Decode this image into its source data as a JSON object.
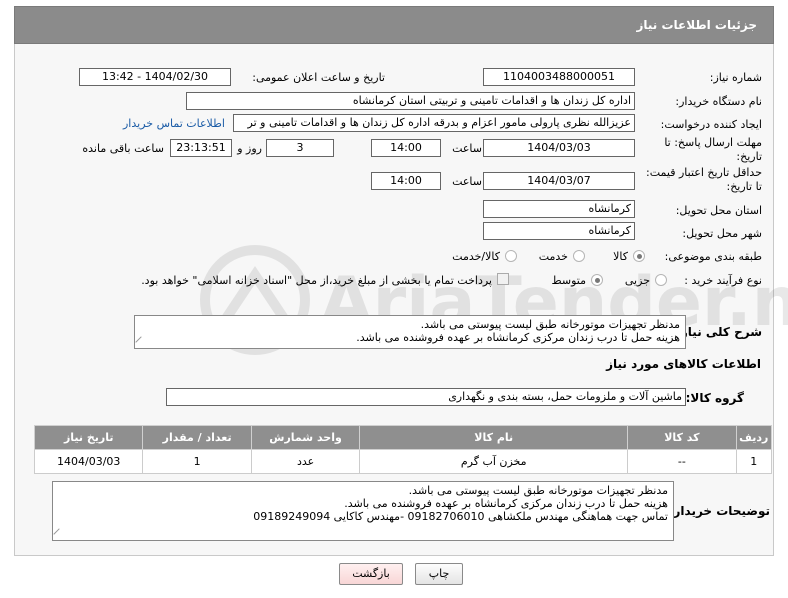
{
  "header": {
    "title": "جزئیات اطلاعات نیاز"
  },
  "fields": {
    "need_number_label": "شماره نیاز:",
    "need_number": "1104003488000051",
    "announce_label": "تاریخ و ساعت اعلان عمومی:",
    "announce_value": "1404/02/30 - 13:42",
    "buyer_org_label": "نام دستگاه خریدار:",
    "buyer_org": "اداره کل زندان ها و اقدامات تامینی و تربیتی استان کرمانشاه",
    "requester_label": "ایجاد کننده درخواست:",
    "requester": "عزیزالله نظری پارولی مامور اعزام و بدرقه اداره کل زندان ها و اقدامات تامینی و تر",
    "contact_link": "اطلاعات تماس خریدار",
    "reply_deadline_label_1": "مهلت ارسال پاسخ: تا",
    "reply_deadline_label_2": "تاریخ:",
    "reply_date": "1404/03/03",
    "time_label": "ساعت",
    "reply_time": "14:00",
    "days_value": "3",
    "days_label": "روز و",
    "remaining_time": "23:13:51",
    "remaining_label": "ساعت باقی مانده",
    "price_validity_label_1": "حداقل تاریخ اعتبار قیمت:",
    "price_validity_label_2": "تا تاریخ:",
    "price_date": "1404/03/07",
    "price_time": "14:00",
    "delivery_province_label": "استان محل تحویل:",
    "delivery_province": "کرمانشاه",
    "delivery_city_label": "شهر محل تحویل:",
    "delivery_city": "کرمانشاه",
    "category_label": "طبقه بندی موضوعی:",
    "category_options": [
      "کالا",
      "خدمت",
      "کالا/خدمت"
    ],
    "purchase_type_label": "نوع فرآیند خرید :",
    "purchase_options": [
      "جزیی",
      "متوسط"
    ],
    "payment_note": "پرداخت تمام یا بخشی از مبلغ خرید،از محل \"اسناد خزانه اسلامی\" خواهد بود."
  },
  "description": {
    "label": "شرح کلی نیاز:",
    "text": "مدنظر تجهیزات موتورخانه طبق لیست پیوستی می باشد.\nهزینه حمل تا درب زندان مرکزی کرمانشاه بر عهده فروشنده می باشد."
  },
  "goods_section": {
    "title": "اطلاعات کالاهای مورد نیاز",
    "group_label": "گروه کالا:",
    "group_value": "ماشین آلات و ملزومات حمل، بسته بندی و نگهداری"
  },
  "table": {
    "headers": [
      "ردیف",
      "کد کالا",
      "نام کالا",
      "واحد شمارش",
      "تعداد / مقدار",
      "تاریخ نیاز"
    ],
    "rows": [
      [
        "1",
        "--",
        "مخزن آب گرم",
        "عدد",
        "1",
        "1404/03/03"
      ]
    ]
  },
  "buyer_notes": {
    "label": "توضیحات خریدار:",
    "text": "مدنظر تجهیزات موتورخانه طبق لیست پیوستی می باشد.\nهزینه حمل تا درب زندان مرکزی کرمانشاه بر عهده فروشنده می باشد.\nتماس جهت هماهنگی مهندس ملکشاهی 09182706010 -مهندس کاکایی 09189249094"
  },
  "buttons": {
    "print": "چاپ",
    "back": "بازگشت"
  },
  "watermark": "AriaTender.net",
  "colors": {
    "header_bg": "#8b8b8b",
    "link": "#1a5ba6",
    "back_button_bg": "#fde4e4"
  }
}
